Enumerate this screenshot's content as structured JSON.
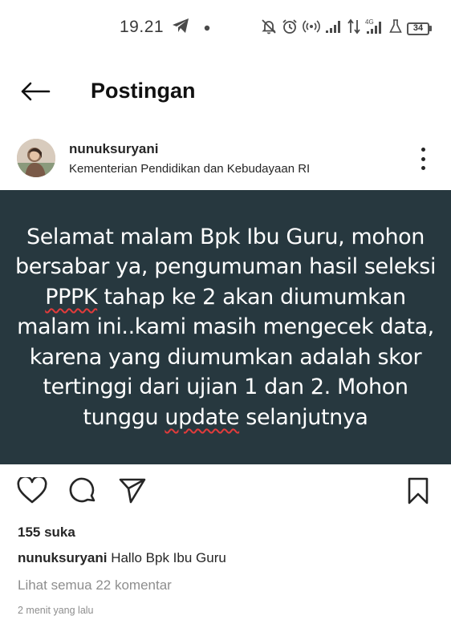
{
  "status_bar": {
    "time": "19.21",
    "battery": "34",
    "icons": [
      "telegram-icon",
      "dot-icon",
      "notifications-off-icon",
      "alarm-icon",
      "hotspot-icon",
      "signal-icon",
      "data-arrows-icon",
      "signal-4g-icon",
      "lab-icon",
      "battery-icon"
    ]
  },
  "header": {
    "title": "Postingan",
    "back_icon": "arrow-left-icon"
  },
  "post": {
    "username": "nunuksuryani",
    "location": "Kementerian Pendidikan dan Kebudayaan RI",
    "image_text": {
      "line1": "Selamat malam Bpk Ibu Guru, mohon",
      "line2": "bersabar ya, pengumuman hasil seleksi",
      "line3_underlined": "PPPK",
      "line3_rest": " tahap ke 2 akan diumumkan",
      "line4": "malam ini..kami masih mengecek data,",
      "line5": "karena yang diumumkan adalah skor",
      "line6": "tertinggi dari ujian 1 dan 2. Mohon",
      "line7_pre": "tunggu ",
      "line7_underlined": "update",
      "line7_post": " selanjutnya"
    },
    "background_color": "#27383f",
    "likes": "155 suka",
    "caption_user": "nunuksuryani",
    "caption_text": " Hallo  Bpk Ibu Guru",
    "view_comments": "Lihat semua 22 komentar",
    "timestamp": "2 menit yang lalu"
  }
}
